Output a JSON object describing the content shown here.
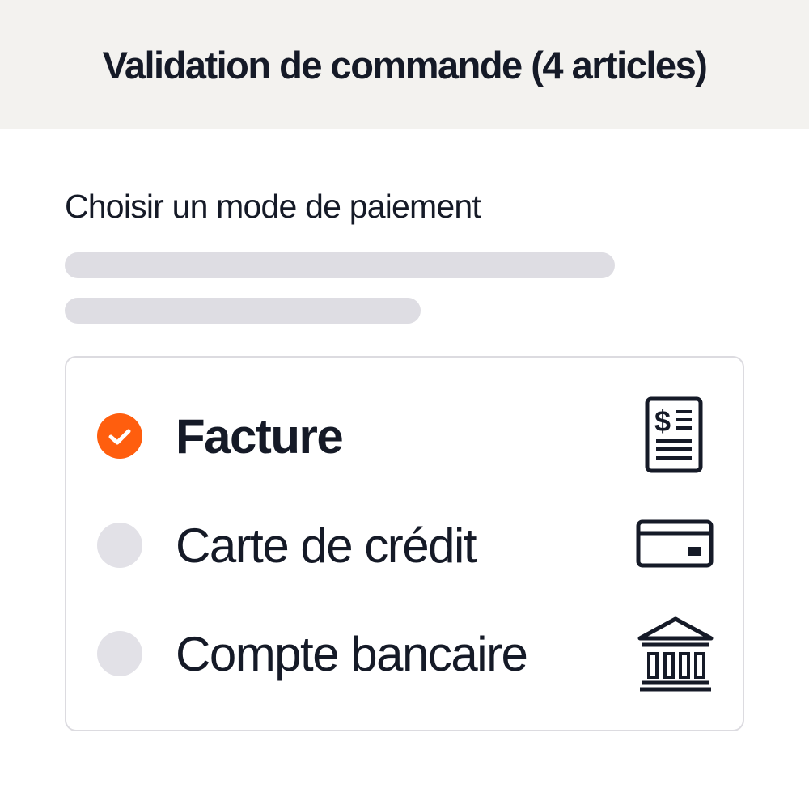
{
  "header": {
    "title": "Validation de commande (4 articles)"
  },
  "payment": {
    "subtitle": "Choisir un mode de paiement",
    "options": [
      {
        "label": "Facture",
        "icon": "invoice-icon",
        "selected": true
      },
      {
        "label": "Carte de crédit",
        "icon": "credit-card-icon",
        "selected": false
      },
      {
        "label": "Compte bancaire",
        "icon": "bank-icon",
        "selected": false
      }
    ]
  },
  "colors": {
    "accent": "#ff5e0e",
    "text": "#151a27",
    "header_bg": "#f3f2ef",
    "skeleton": "#dedde3",
    "radio_unselected": "#e2e1e7"
  }
}
